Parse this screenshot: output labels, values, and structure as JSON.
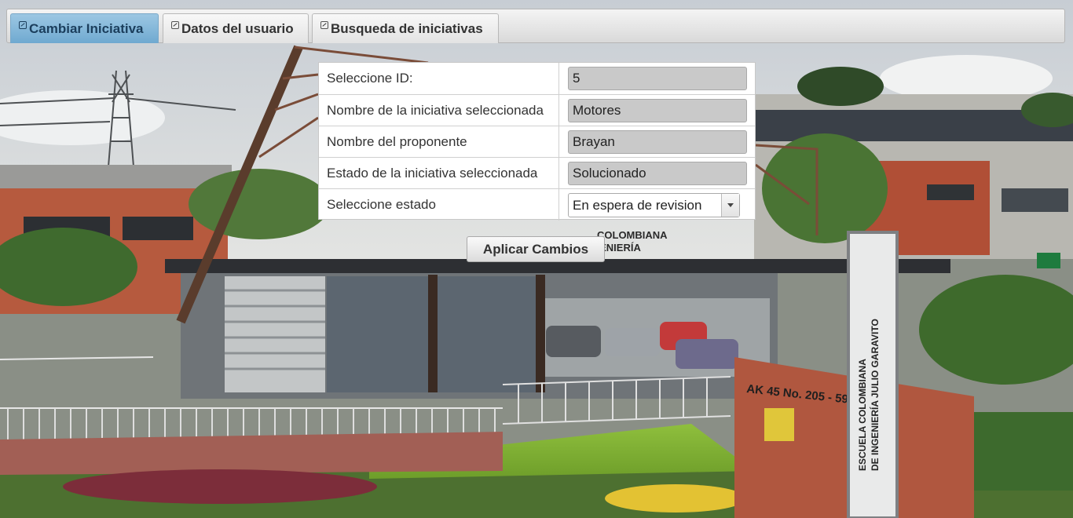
{
  "tabs": [
    {
      "label": "Cambiar Iniciativa",
      "active": true
    },
    {
      "label": "Datos del usuario",
      "active": false
    },
    {
      "label": "Busqueda de iniciativas",
      "active": false
    }
  ],
  "form": {
    "rows": [
      {
        "label": "Seleccione ID:",
        "value": "5"
      },
      {
        "label": "Nombre de la iniciativa seleccionada",
        "value": "Motores"
      },
      {
        "label": "Nombre del proponente",
        "value": "Brayan"
      },
      {
        "label": "Estado de la iniciativa seleccionada",
        "value": "Solucionado"
      }
    ],
    "estado": {
      "label": "Seleccione estado",
      "selected": "En espera de revision"
    }
  },
  "apply_label": "Aplicar Cambios",
  "background": {
    "sign_text": "AK 45 No. 205 - 59",
    "banner_line1": "ESCUELA COLOMBIANA",
    "banner_line2": "DE INGENIERÍA JULIO GARAVITO",
    "building_sign": "COLOMBIANA INGENIERÍA"
  },
  "colors": {
    "active_tab": "#7fb3d7",
    "field_bg": "#c9c9c9"
  }
}
